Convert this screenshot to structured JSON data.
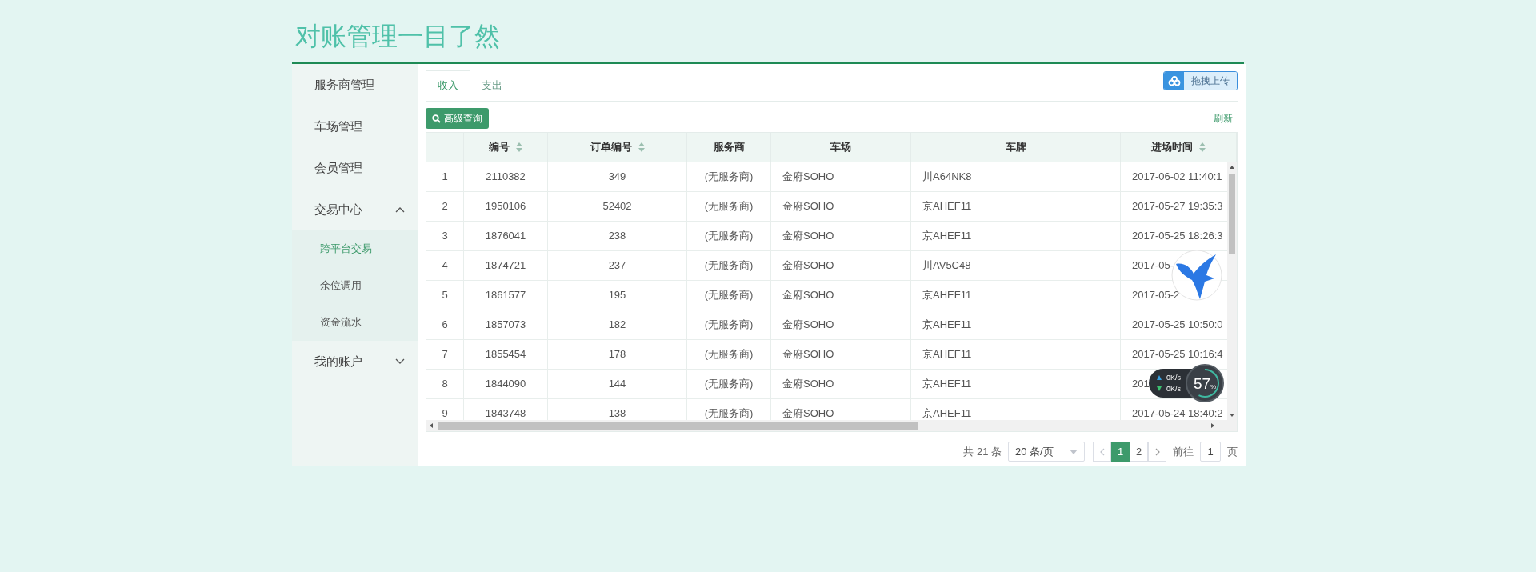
{
  "page_title": "对账管理一目了然",
  "sidebar": {
    "items": [
      {
        "kind": "link",
        "label": "服务商管理"
      },
      {
        "kind": "link",
        "label": "车场管理"
      },
      {
        "kind": "link",
        "label": "会员管理"
      },
      {
        "kind": "group",
        "label": "交易中心",
        "expanded": true,
        "children": [
          {
            "label": "跨平台交易",
            "selected": true
          },
          {
            "label": "余位调用",
            "selected": false
          },
          {
            "label": "资金流水",
            "selected": false
          }
        ]
      },
      {
        "kind": "group",
        "label": "我的账户",
        "expanded": false
      }
    ]
  },
  "tabs": [
    {
      "label": "收入",
      "selected": true
    },
    {
      "label": "支出",
      "selected": false
    }
  ],
  "upload_button": "拖拽上传",
  "search_button": "高级查询",
  "refresh_link": "刷新",
  "table": {
    "columns": [
      {
        "label": "编号",
        "sortable": true
      },
      {
        "label": "订单编号",
        "sortable": true
      },
      {
        "label": "服务商",
        "sortable": false
      },
      {
        "label": "车场",
        "sortable": false
      },
      {
        "label": "车牌",
        "sortable": false
      },
      {
        "label": "进场时间",
        "sortable": true
      }
    ],
    "rows": [
      {
        "index": "1",
        "cells": [
          "2110382",
          "349",
          "(无服务商)",
          "金府SOHO",
          "川A64NK8",
          "2017-06-02 11:40:1"
        ]
      },
      {
        "index": "2",
        "cells": [
          "1950106",
          "52402",
          "(无服务商)",
          "金府SOHO",
          "京AHEF11",
          "2017-05-27 19:35:3"
        ]
      },
      {
        "index": "3",
        "cells": [
          "1876041",
          "238",
          "(无服务商)",
          "金府SOHO",
          "京AHEF11",
          "2017-05-25 18:26:3"
        ]
      },
      {
        "index": "4",
        "cells": [
          "1874721",
          "237",
          "(无服务商)",
          "金府SOHO",
          "川AV5C48",
          "2017-05-"
        ]
      },
      {
        "index": "5",
        "cells": [
          "1861577",
          "195",
          "(无服务商)",
          "金府SOHO",
          "京AHEF11",
          "2017-05-2"
        ]
      },
      {
        "index": "6",
        "cells": [
          "1857073",
          "182",
          "(无服务商)",
          "金府SOHO",
          "京AHEF11",
          "2017-05-25 10:50:0"
        ]
      },
      {
        "index": "7",
        "cells": [
          "1855454",
          "178",
          "(无服务商)",
          "金府SOHO",
          "京AHEF11",
          "2017-05-25 10:16:4"
        ]
      },
      {
        "index": "8",
        "cells": [
          "1844090",
          "144",
          "(无服务商)",
          "金府SOHO",
          "京AHEF11",
          "201"
        ]
      },
      {
        "index": "9",
        "cells": [
          "1843748",
          "138",
          "(无服务商)",
          "金府SOHO",
          "京AHEF11",
          "2017-05-24 18:40:2"
        ]
      }
    ]
  },
  "pagination": {
    "total": "共 21 条",
    "page_size": "20 条/页",
    "pages": [
      {
        "label": "1",
        "selected": true
      },
      {
        "label": "2",
        "selected": false
      }
    ],
    "goto_label": "前往",
    "goto_value": "1",
    "page_unit": "页"
  },
  "speed_widget": {
    "upload": "0K/s",
    "download": "0K/s",
    "percent": "57",
    "percent_sign": "%"
  }
}
